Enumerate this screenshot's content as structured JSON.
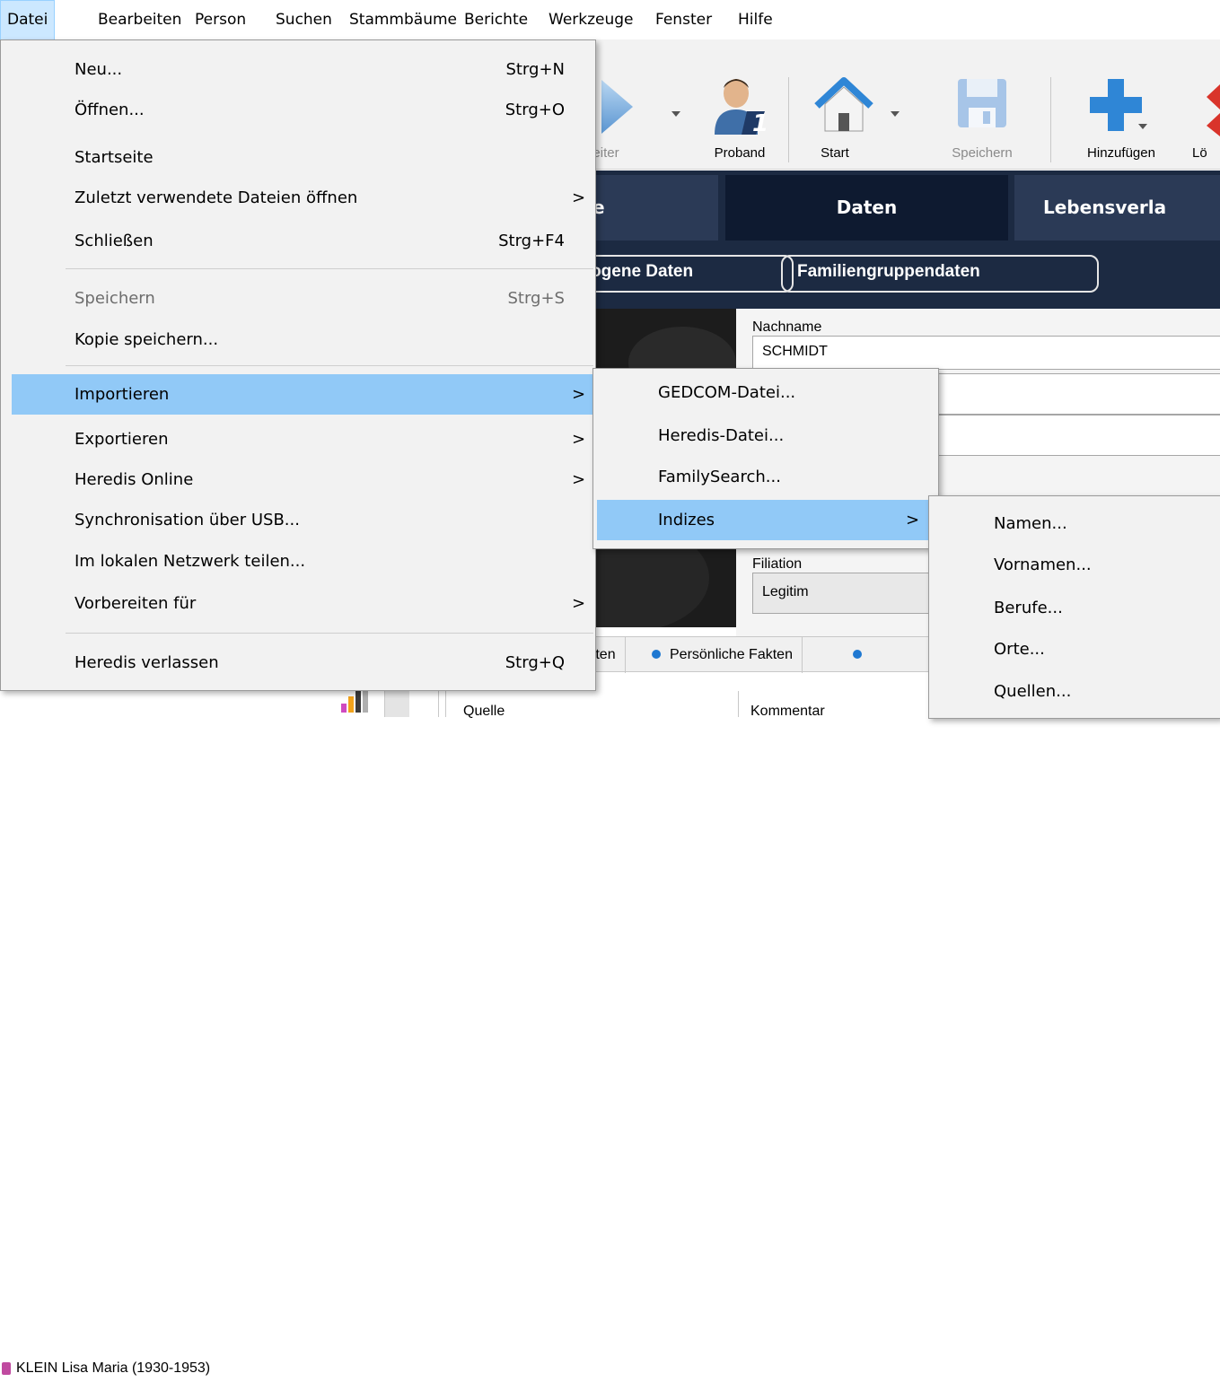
{
  "menubar": [
    "Datei",
    "Bearbeiten",
    "Person",
    "Suchen",
    "Stammbäume",
    "Berichte",
    "Werkzeuge",
    "Fenster",
    "Hilfe"
  ],
  "toolbar": {
    "weiter": "eiter",
    "proband": "Proband",
    "start": "Start",
    "speichern": "Speichern",
    "hinzufuegen": "Hinzufügen",
    "loeschen": "Lö"
  },
  "tabs": {
    "left": "e",
    "daten": "Daten",
    "lebensverlauf": "Lebensverla"
  },
  "subtabs": {
    "bezogene": "ezogene Daten",
    "familiengruppe": "Familiengruppendaten"
  },
  "form": {
    "nachname_label": "Nachname",
    "nachname_value": "SCHMIDT",
    "filiation_label": "Filiation",
    "filiation_value": "Legitim"
  },
  "facts": {
    "tab1": "aften",
    "tab2": "Persönliche Fakten"
  },
  "bottom": {
    "quelle": "Quelle",
    "kommentar": "Kommentar"
  },
  "person_row": "KLEIN Lisa Maria (1930-1953)",
  "file_menu": {
    "neu": "Neu...",
    "neu_sc": "Strg+N",
    "oeffnen": "Öffnen...",
    "oeffnen_sc": "Strg+O",
    "startseite": "Startseite",
    "zuletzt": "Zuletzt verwendete Dateien öffnen",
    "schliessen": "Schließen",
    "schliessen_sc": "Strg+F4",
    "speichern": "Speichern",
    "speichern_sc": "Strg+S",
    "kopie": "Kopie speichern...",
    "importieren": "Importieren",
    "exportieren": "Exportieren",
    "heredis_online": "Heredis Online",
    "sync_usb": "Synchronisation über USB...",
    "netzwerk": "Im lokalen Netzwerk teilen...",
    "vorbereiten": "Vorbereiten für",
    "verlassen": "Heredis verlassen",
    "verlassen_sc": "Strg+Q"
  },
  "import_menu": [
    "GEDCOM-Datei...",
    "Heredis-Datei...",
    "FamilySearch...",
    "Indizes"
  ],
  "indizes_menu": [
    "Namen...",
    "Vornamen...",
    "Berufe...",
    "Orte...",
    "Quellen..."
  ],
  "arrow": ">"
}
